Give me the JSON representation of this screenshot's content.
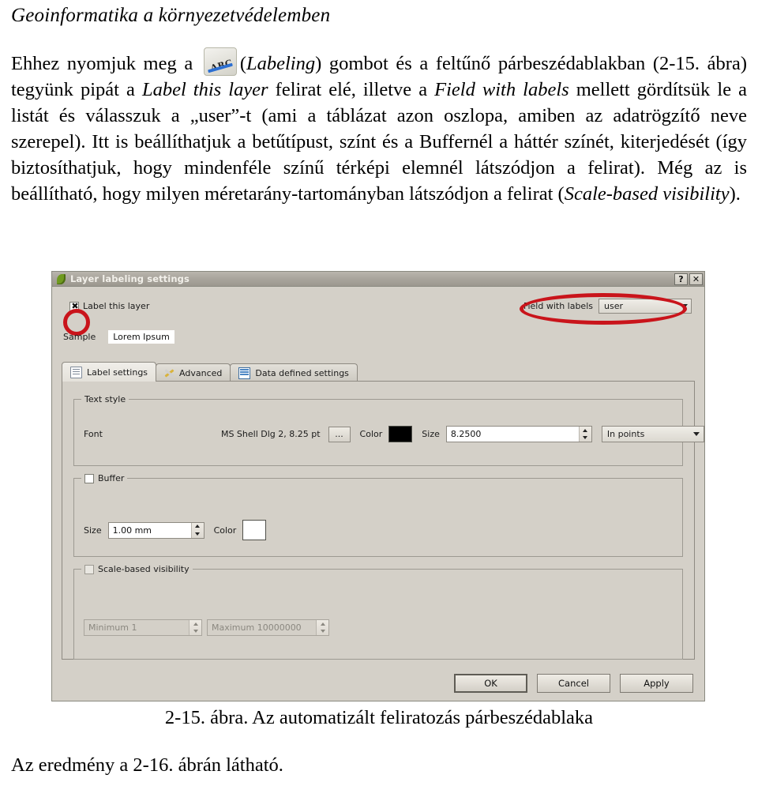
{
  "running_head": "Geoinformatika a környezetvédelemben",
  "paragraph": {
    "seg1": "Ehhez nyomjuk meg a ",
    "icon_name": "labeling-toolbar-icon",
    "icon_text": "ABC",
    "seg2": "(",
    "em1": "Labeling",
    "seg3": ") gombot és a feltűnő párbeszédablakban (2-15. ábra) tegyünk pipát a ",
    "em2": "Label this layer",
    "seg4": " felirat elé, illetve a ",
    "em3": "Field with labels",
    "seg5": " mellett gördítsük le a listát és válasszuk a „user”-t (ami a táblázat azon oszlopa, amiben az adatrögzítő neve szerepel). Itt is beállíthatjuk a betűtípust, színt és a Buffernél a háttér színét, kiterjedését (így biztosíthatjuk, hogy mindenféle színű térképi elemnél látszódjon a felirat). Még az is beállítható, hogy milyen méretarány-tartományban látszódjon a felirat (",
    "em4": "Scale-based visibility",
    "seg6": ")."
  },
  "dialog": {
    "title": "Layer labeling settings",
    "app_icon": "qgis-leaf-icon",
    "titlebar_buttons": [
      {
        "name": "help-button",
        "label": "?"
      },
      {
        "name": "close-button",
        "label": "✕"
      }
    ],
    "label_this_layer": {
      "label": "Label this layer",
      "checked": true
    },
    "field_with_labels": {
      "caption": "Field with labels",
      "value": "user"
    },
    "sample": {
      "caption": "Sample",
      "value": "Lorem Ipsum"
    },
    "tabs": [
      {
        "label": "Label settings",
        "icon": "list-icon",
        "active": true
      },
      {
        "label": "Advanced",
        "icon": "tools-icon",
        "active": false
      },
      {
        "label": "Data defined settings",
        "icon": "table-icon",
        "active": false
      }
    ],
    "text_style": {
      "group_title": "Text style",
      "font_caption": "Font",
      "font_value": "MS Shell Dlg 2, 8.25 pt",
      "font_browse_label": "...",
      "color_caption": "Color",
      "color_value": "#000000",
      "size_caption": "Size",
      "size_value": "8.2500",
      "units_value": "In points"
    },
    "buffer": {
      "group_title": "Buffer",
      "checked": true,
      "size_caption": "Size",
      "size_value": "1.00 mm",
      "color_caption": "Color",
      "color_value": "#ffffff"
    },
    "scale_visibility": {
      "group_title": "Scale-based visibility",
      "checked": false,
      "minimum_value": "Minimum 1",
      "maximum_value": "Maximum 10000000"
    },
    "footer_buttons": [
      {
        "name": "ok-button",
        "label": "OK",
        "default": true
      },
      {
        "name": "cancel-button",
        "label": "Cancel",
        "default": false
      },
      {
        "name": "apply-button",
        "label": "Apply",
        "default": false
      }
    ],
    "annotations": {
      "accent_color": "#c9141b",
      "items": [
        {
          "name": "annotation-ellipse-label-checkbox",
          "target": "Label this layer checkbox"
        },
        {
          "name": "annotation-ellipse-field-combo",
          "target": "Field with labels combo"
        }
      ]
    }
  },
  "figure_caption": "2-15. ábra. Az automatizált feliratozás párbeszédablaka",
  "closing_text": "Az eredmény a 2-16. ábrán látható."
}
